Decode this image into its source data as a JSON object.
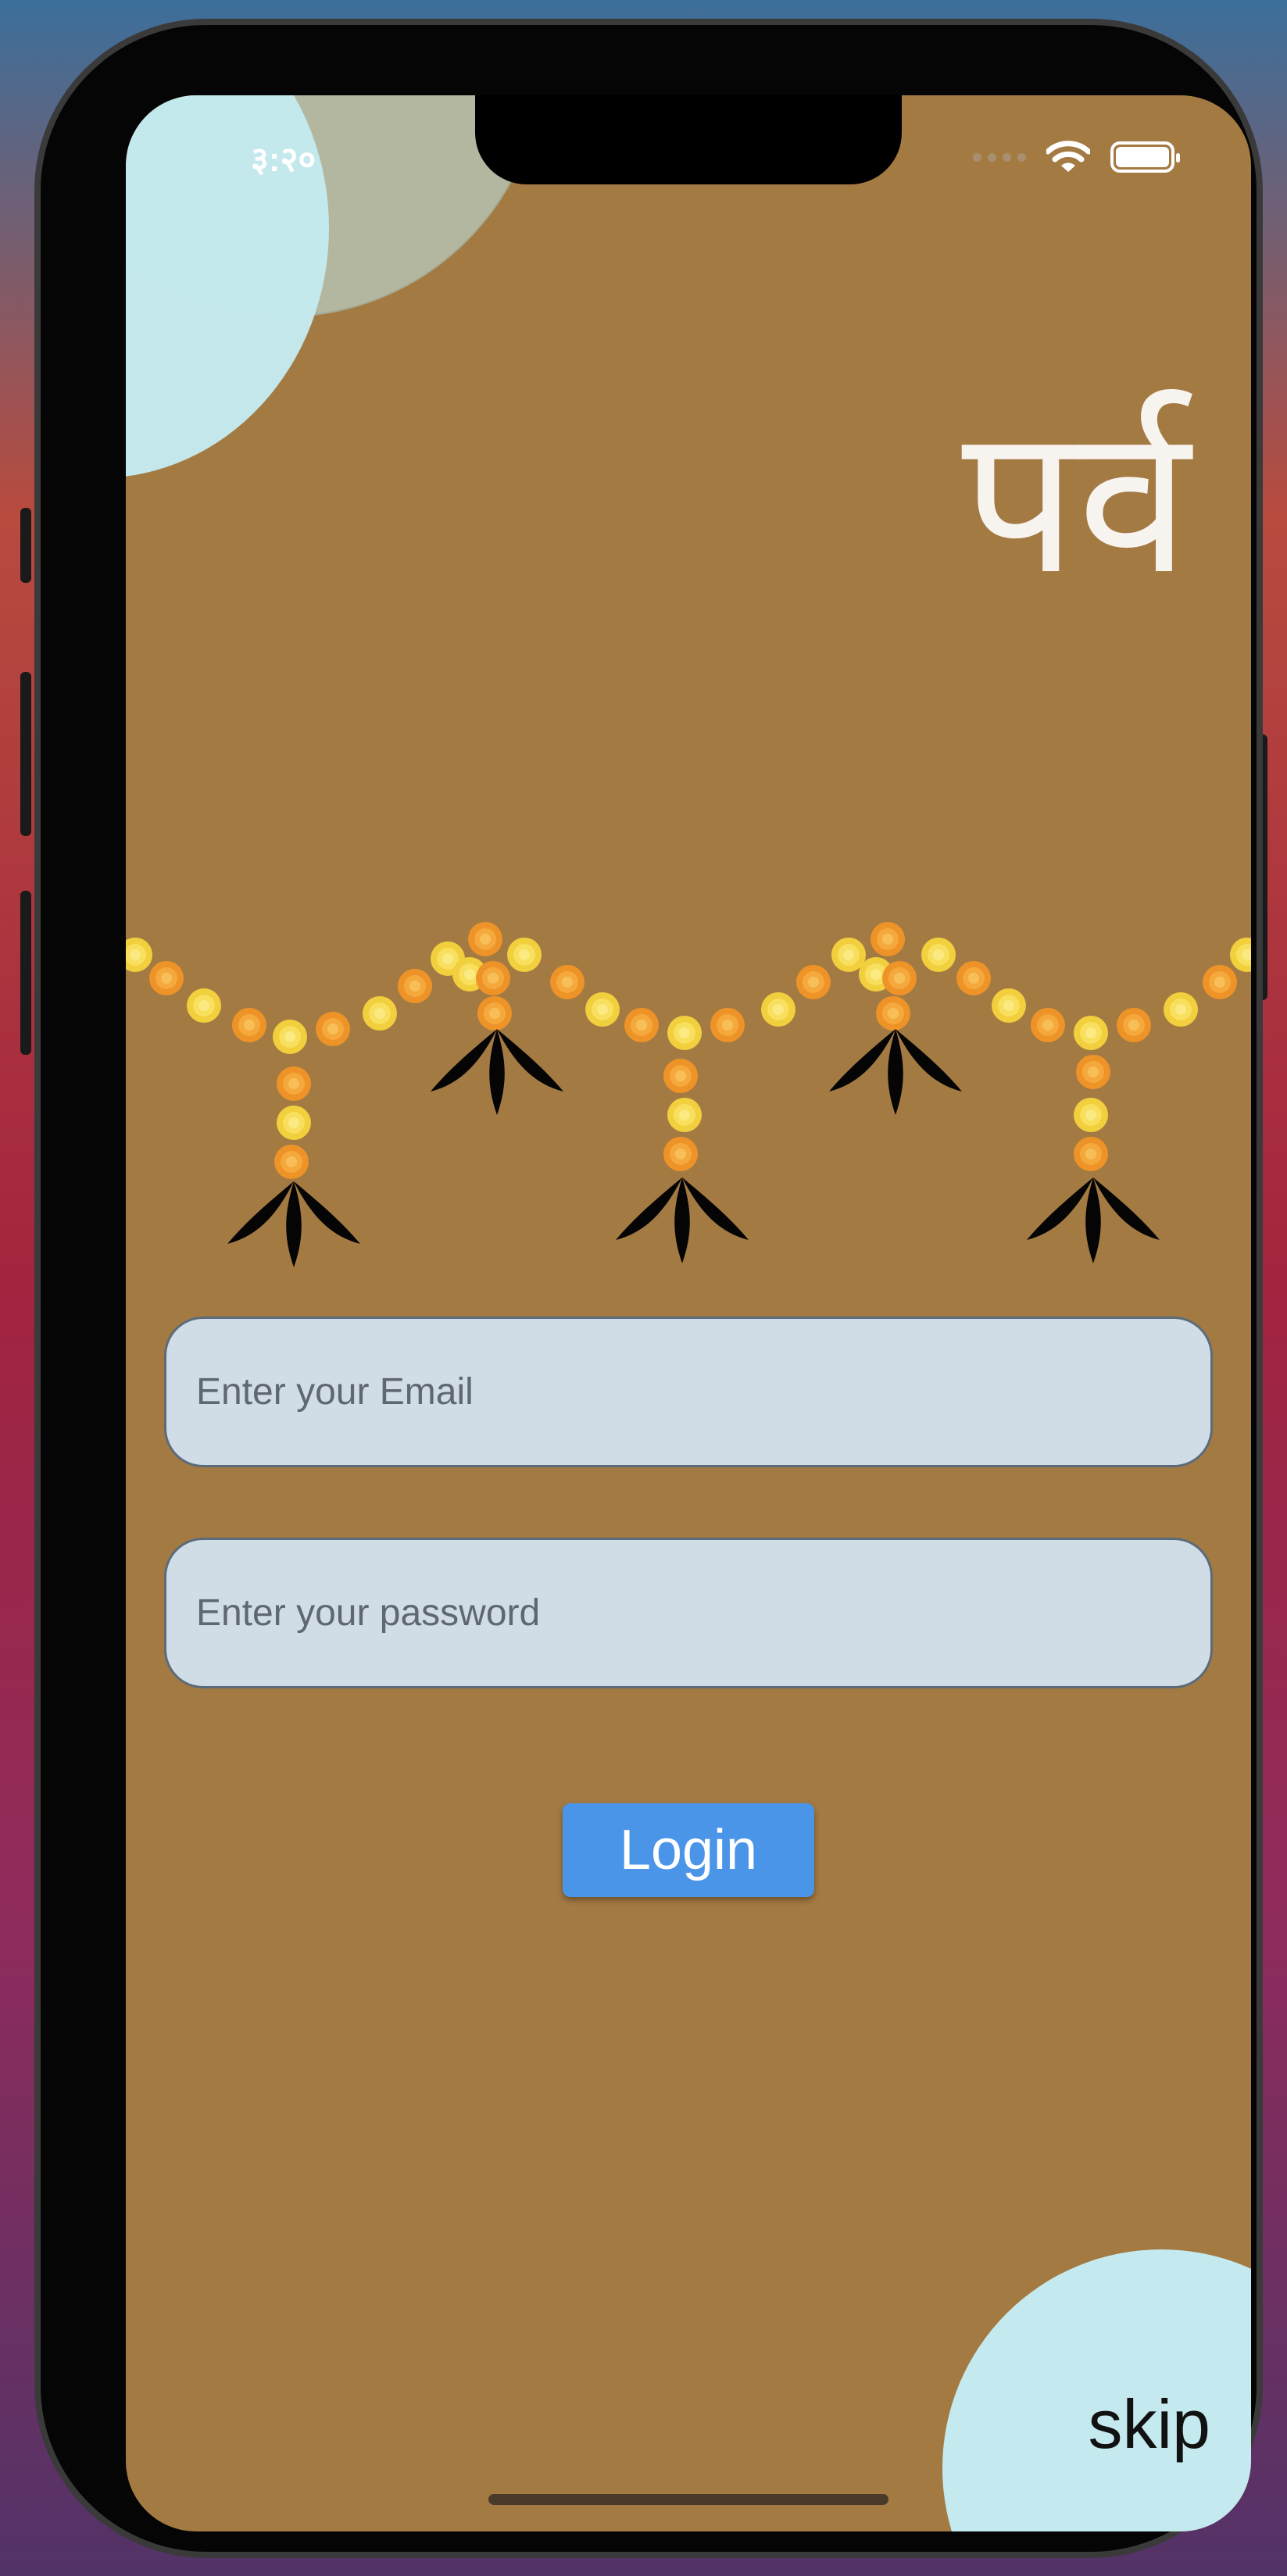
{
  "status_bar": {
    "time": "३:२०"
  },
  "app": {
    "title": "पर्व"
  },
  "login_form": {
    "email_placeholder": "Enter your Email",
    "password_placeholder": "Enter your password",
    "login_label": "Login"
  },
  "skip_label": "skip",
  "colors": {
    "background": "#a47a43",
    "accent_circle": "#c4eaef",
    "button": "#4b95e9",
    "field": "#d1dde6"
  },
  "icons": {
    "wifi": "wifi-icon",
    "battery": "battery-icon",
    "signal": "cellular-signal-icon",
    "garland": "marigold-garland-icon"
  }
}
